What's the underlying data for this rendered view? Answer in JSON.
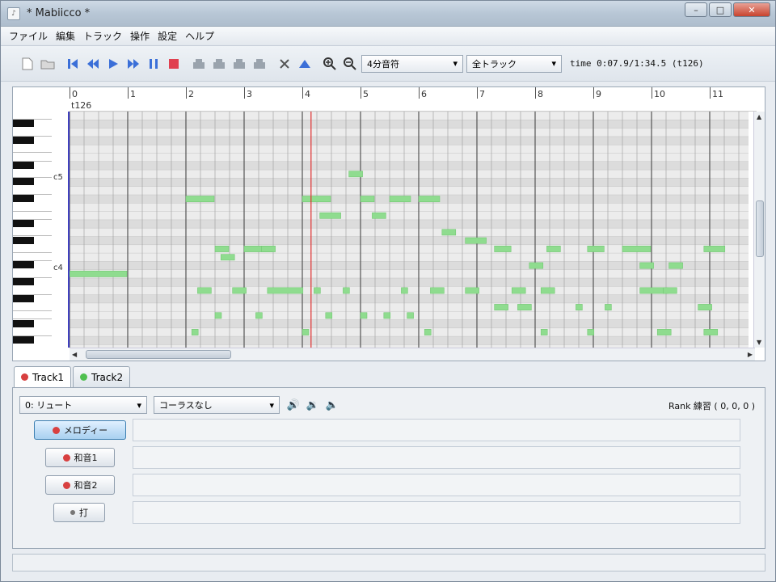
{
  "window": {
    "title": "* Mabiicco *"
  },
  "menu": [
    "ファイル",
    "編集",
    "トラック",
    "操作",
    "設定",
    "ヘルプ"
  ],
  "toolbar": {
    "note_length": "4分音符",
    "track_select": "全トラック",
    "time": "time 0:07.9/1:34.5 (t126)"
  },
  "editor": {
    "measures": [
      "0",
      "1",
      "2",
      "3",
      "4",
      "5",
      "6",
      "7",
      "8",
      "9",
      "10",
      "11"
    ],
    "tempo_label": "t126",
    "octave_labels": [
      "c5",
      "c4"
    ],
    "playhead_measure": 4.15,
    "note_color": "#8fdc8f"
  },
  "tabs": [
    {
      "label": "Track1",
      "color": "#d84040",
      "active": true
    },
    {
      "label": "Track2",
      "color": "#50c050",
      "active": false
    }
  ],
  "track": {
    "instrument": "0: リュート",
    "chorus": "コーラスなし",
    "rank": "Rank 練習 ( 0, 0, 0 )",
    "parts": [
      {
        "label": "メロディー",
        "color": "#d84040",
        "selected": true
      },
      {
        "label": "和音1",
        "color": "#d84040",
        "selected": false
      },
      {
        "label": "和音2",
        "color": "#d84040",
        "selected": false
      },
      {
        "label": "打",
        "color": "#777777",
        "selected": false
      }
    ]
  }
}
